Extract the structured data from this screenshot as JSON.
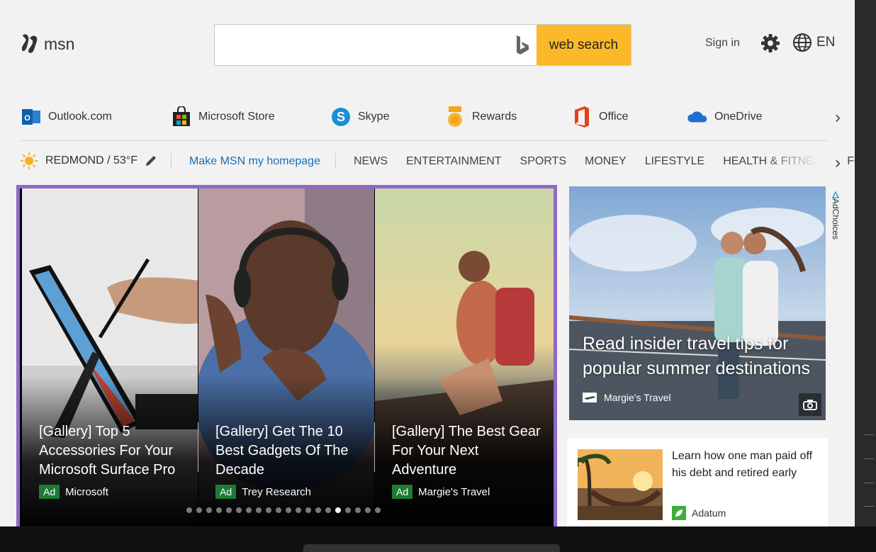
{
  "header": {
    "logo_text": "msn",
    "search_placeholder": "",
    "search_button": "web search",
    "sign_in": "Sign in",
    "language": "EN"
  },
  "quicklinks": [
    {
      "label": "Outlook.com",
      "icon": "outlook-icon"
    },
    {
      "label": "Microsoft Store",
      "icon": "store-icon"
    },
    {
      "label": "Skype",
      "icon": "skype-icon"
    },
    {
      "label": "Rewards",
      "icon": "rewards-icon"
    },
    {
      "label": "Office",
      "icon": "office-icon"
    },
    {
      "label": "OneDrive",
      "icon": "onedrive-icon"
    }
  ],
  "navbar": {
    "weather": "REDMOND / 53°F",
    "make_home": "Make MSN my homepage",
    "links": [
      "NEWS",
      "ENTERTAINMENT",
      "SPORTS",
      "MONEY",
      "LIFESTYLE",
      "HEALTH & FITNESS",
      "FO"
    ]
  },
  "carousel": {
    "slides": [
      {
        "title": "[Gallery] Top 5 Accessories For Your Microsoft Surface Pro",
        "badge": "Ad",
        "source": "Microsoft"
      },
      {
        "title": "[Gallery] Get The 10 Best Gadgets Of The Decade",
        "badge": "Ad",
        "source": "Trey Research"
      },
      {
        "title": "[Gallery] The Best Gear For Your Next Adventure",
        "badge": "Ad",
        "source": "Margie's Travel"
      }
    ],
    "dot_count": 20,
    "active_dot": 15
  },
  "hero": {
    "title": "Read insider travel tips for popular summer destinations",
    "source": "Margie's Travel"
  },
  "adchoices": "AdChoices",
  "card2": {
    "title": "Learn how one man paid off his debt and retired early",
    "source": "Adatum"
  },
  "colors": {
    "search_button": "#fbb92a",
    "carousel_border": "#8e68c8",
    "link_blue": "#1a6fb5",
    "ad_badge": "#1e7b34"
  }
}
